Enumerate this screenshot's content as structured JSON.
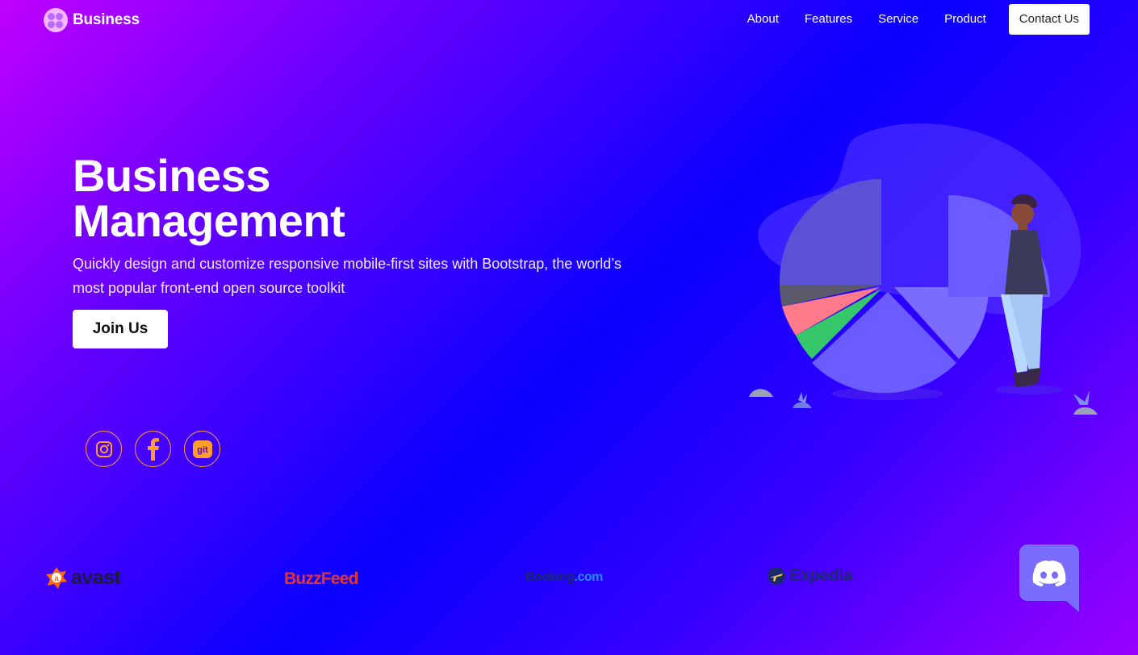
{
  "brand": {
    "name": "Business"
  },
  "nav": {
    "links": [
      "About",
      "Features",
      "Service",
      "Product"
    ],
    "contact_label": "Contact Us"
  },
  "hero": {
    "title_line1": "Business",
    "title_line2": "Management",
    "subtitle": "Quickly design and customize responsive mobile-first sites with Bootstrap, the world’s most popular front-end open source toolkit",
    "cta_label": "Join Us"
  },
  "socials": [
    {
      "icon": "instagram-icon"
    },
    {
      "icon": "facebook-icon"
    },
    {
      "icon": "git-icon",
      "text": "git"
    }
  ],
  "partners": {
    "avast": "avast",
    "buzzfeed": "BuzzFeed",
    "booking_main": "Booking",
    "booking_tld": ".com",
    "expedia": "Expedia"
  },
  "colors": {
    "accent_orange": "#ff9e2a",
    "pie_main": "#6b5cff",
    "pie_dark": "#5a4fd0",
    "discord": "#7a6cff"
  }
}
